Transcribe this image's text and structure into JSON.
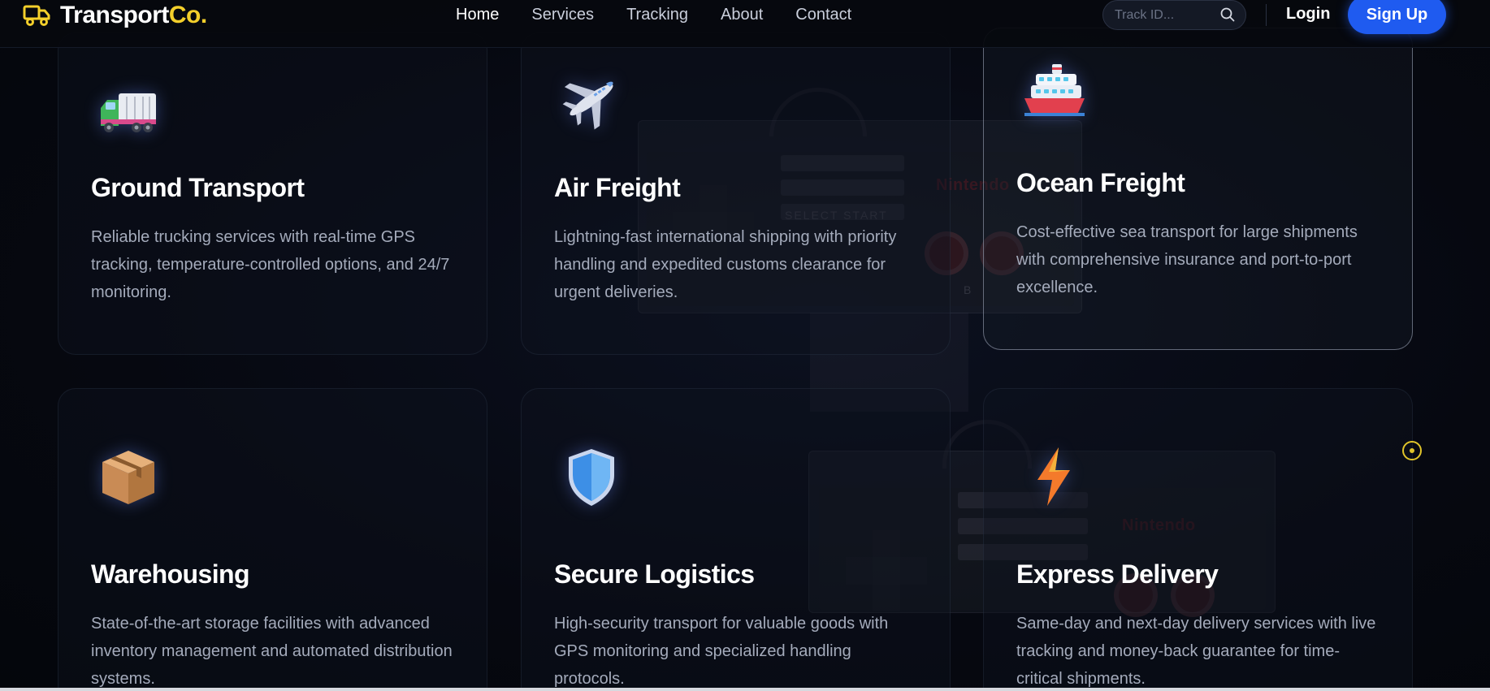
{
  "brand": {
    "name_part1": "Transport",
    "name_part2": "Co.",
    "accent": "#f3cf2b"
  },
  "nav": [
    {
      "label": "Home",
      "active": true
    },
    {
      "label": "Services"
    },
    {
      "label": "Tracking"
    },
    {
      "label": "About"
    },
    {
      "label": "Contact"
    }
  ],
  "search": {
    "placeholder": "Track ID...",
    "icon": "search-icon"
  },
  "auth": {
    "login_label": "Login",
    "signup_label": "Sign Up",
    "signup_color": "#1f5bf0"
  },
  "background": {
    "brand_text": "Nintendo",
    "select_start": "SELECT  START",
    "button_label": "B"
  },
  "services": [
    {
      "title": "Ground Transport",
      "description": "Reliable trucking services with real-time GPS tracking, temperature-controlled options, and 24/7 monitoring.",
      "icon": "truck-icon"
    },
    {
      "title": "Air Freight",
      "description": "Lightning-fast international shipping with priority handling and expedited customs clearance for urgent deliveries.",
      "icon": "airplane-icon"
    },
    {
      "title": "Ocean Freight",
      "description": "Cost-effective sea transport for large shipments with comprehensive insurance and port-to-port excellence.",
      "icon": "ship-icon"
    },
    {
      "title": "Warehousing",
      "description": "State-of-the-art storage facilities with advanced inventory management and automated distribution systems.",
      "icon": "package-icon"
    },
    {
      "title": "Secure Logistics",
      "description": "High-security transport for valuable goods with GPS monitoring and specialized handling protocols.",
      "icon": "shield-icon"
    },
    {
      "title": "Express Delivery",
      "description": "Same-day and next-day delivery services with live tracking and money-back guarantee for time-critical shipments.",
      "icon": "lightning-icon"
    }
  ]
}
